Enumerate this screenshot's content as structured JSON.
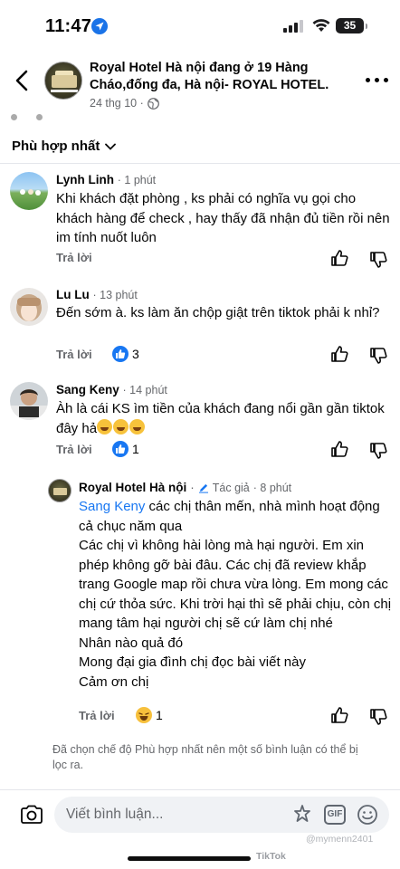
{
  "status": {
    "time": "11:47",
    "battery": "35"
  },
  "post": {
    "title": "Royal Hotel Hà nội đang ở 19 Hàng Cháo,đống đa, Hà nội- ROYAL HOTEL.",
    "date": "24 thg 10 ·"
  },
  "sort": {
    "label": "Phù hợp nhất"
  },
  "comments": [
    {
      "name": "Lynh Linh",
      "time": "· 1 phút",
      "text": "Khi khách đặt phòng , ks phải có nghĩa vụ gọi cho khách hàng để check , hay thấy đã  nhận đủ tiền rồi nên im tính nuốt luôn",
      "reply": "Trả lời"
    },
    {
      "name": "Lu Lu",
      "time": "· 13 phút",
      "text": "Đến sớm à. ks làm ăn chộp giật trên tiktok phải k nhỉ?",
      "reply": "Trả lời",
      "likes": "3"
    },
    {
      "name": "Sang Keny",
      "time": "· 14 phút",
      "text": "Àh là cái KS ìm tiền của khách đang nổi gần gần tiktok đây hả",
      "reply": "Trả lời",
      "likes": "1"
    }
  ],
  "reply_comment": {
    "name": "Royal Hotel Hà nội",
    "author_badge": "Tác giả",
    "time": "· 8 phút",
    "mention": "Sang Keny",
    "lines": [
      " các chị thân mến, nhà mình hoạt động cả chục năm qua",
      "Các chị vì không hài lòng mà hại người. Em xin phép không gỡ bài đâu. Các chị đã review khắp trang Google map rồi chưa vừa lòng. Em mong các chị cứ thỏa sức. Khi trời hại thì sẽ phải chịu, còn chị mang tâm hại người chị sẽ cứ làm chị nhé",
      "Nhân nào quả đó",
      "Mong đại gia đình chị đọc bài viết này",
      "Cảm ơn chị"
    ],
    "reply": "Trả lời",
    "reactions": "1"
  },
  "filter_note": "Đã chọn chế độ Phù hợp nhất nên một số bình luận có thể bị lọc ra.",
  "composer": {
    "placeholder": "Viết bình luận...",
    "gif": "GIF"
  },
  "watermark": {
    "handle": "@mymenn2401",
    "brand": "TikTok"
  }
}
